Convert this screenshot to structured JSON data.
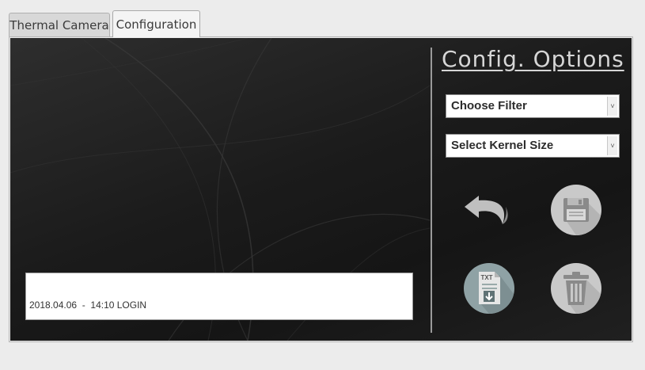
{
  "tabs": [
    {
      "label": "Thermal Camera",
      "active": false
    },
    {
      "label": "Configuration",
      "active": true
    }
  ],
  "config": {
    "title": "Config. Options",
    "filter_select": {
      "selected": "Choose Filter"
    },
    "kernel_select": {
      "selected": "Select Kernel Size"
    },
    "export_icon_text": "TXT",
    "buttons": [
      {
        "icon": "undo-icon"
      },
      {
        "icon": "save-icon"
      },
      {
        "icon": "export-txt-icon"
      },
      {
        "icon": "trash-icon"
      }
    ]
  },
  "log": {
    "entries": [
      "2018.04.06  -  14:10 LOGIN"
    ]
  },
  "colors": {
    "background": "#1b1b1b",
    "button_circle": "#c9c9c9",
    "export_circle": "#8fa2a5",
    "text_light": "#d6d6d6"
  }
}
